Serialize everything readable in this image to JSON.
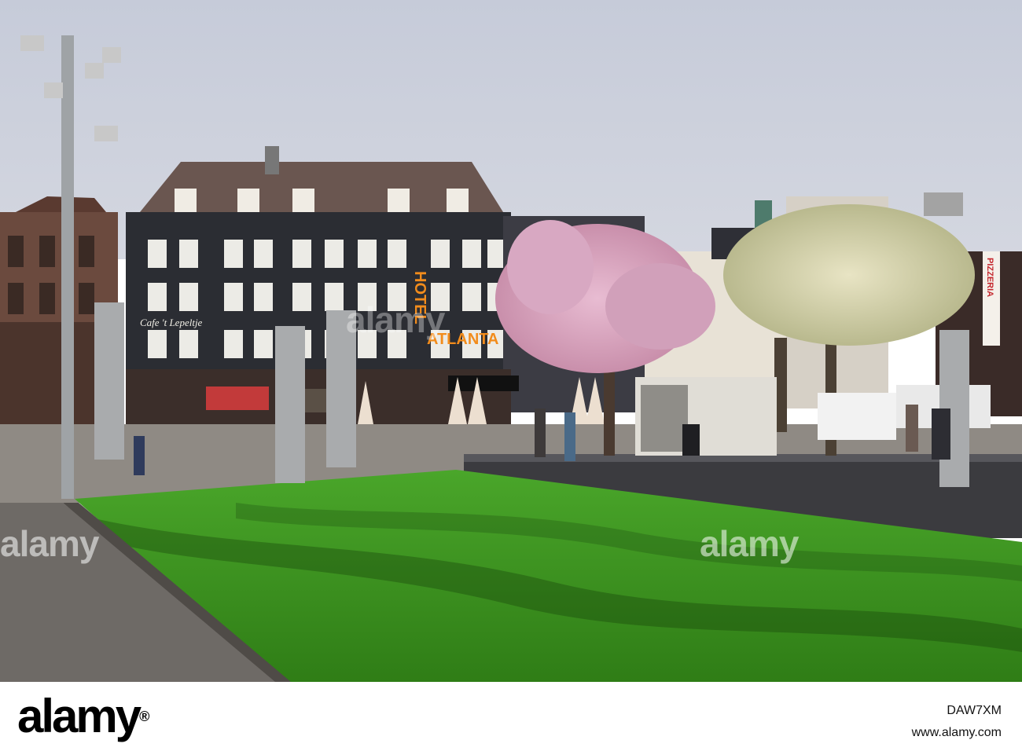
{
  "signs": {
    "hotel_vertical": "HOTEL",
    "hotel_atlanta": "ATLANTA",
    "cafe": "Cafe 't Lepeltje",
    "pizzeria": "PIZZERIA"
  },
  "watermark": {
    "text": "alamy"
  },
  "footer": {
    "logo": "alamy",
    "image_id": "DAW7XM",
    "url": "www.alamy.com"
  },
  "colors": {
    "sky": "#c9cedb",
    "grass": "#3f9a1f",
    "building_dark": "#2b2d33",
    "sign_orange": "#f28c1c",
    "blossom": "#d9a6c0"
  }
}
